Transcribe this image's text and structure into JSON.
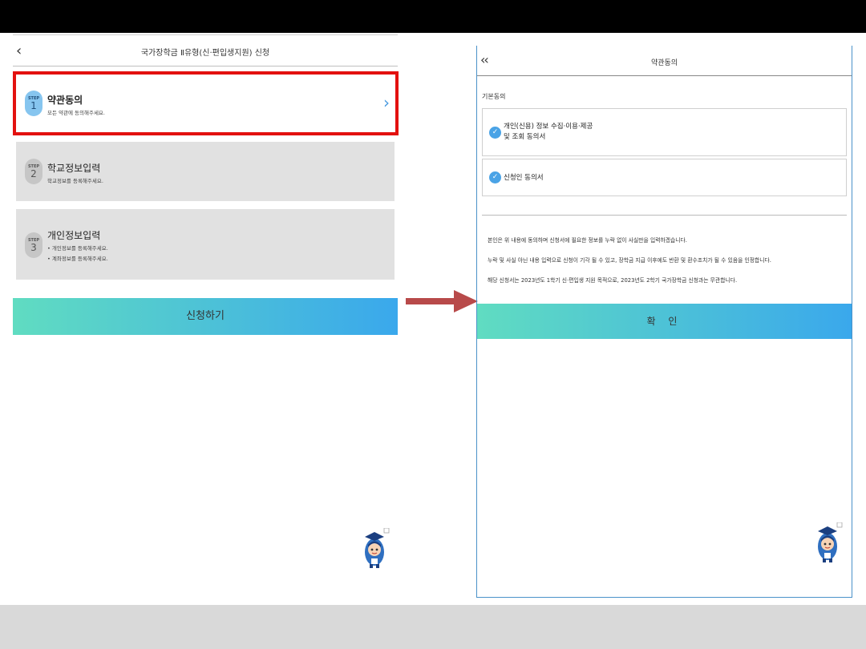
{
  "left_panel": {
    "header": {
      "back_icon": "chevron-left-icon",
      "title": "국가장학금 Ⅱ유형(신·편입생지원) 신청"
    },
    "steps": [
      {
        "step_label": "STEP",
        "number": "1",
        "title": "약관동의",
        "subtitle": "모든 약관에 동의해주세요.",
        "active": true
      },
      {
        "step_label": "STEP",
        "number": "2",
        "title": "학교정보입력",
        "subtitle": "학교정보를 등록해주세요.",
        "active": false
      },
      {
        "step_label": "STEP",
        "number": "3",
        "title": "개인정보입력",
        "bullets": [
          "• 개인정보를 등록해주세요.",
          "• 계좌정보를 등록해주세요."
        ],
        "active": false
      }
    ],
    "apply_button": "신청하기"
  },
  "right_panel": {
    "header": {
      "back_icon": "double-chevron-left-icon",
      "title": "약관동의"
    },
    "section_label": "기본동의",
    "agreements": [
      {
        "text_line1": "개인(신용) 정보 수집·이용·제공",
        "text_line2": "및 조회 동의서",
        "checked": true
      },
      {
        "text_line1": "신청인 동의서",
        "checked": true
      }
    ],
    "notices": [
      "본인은 위 내용에 동의하며 신청서에 필요한 정보를 누락 없이 사실만을 입력하겠습니다.",
      "누락 및 사실 아닌 내용 입력으로 신청이 기각 될 수 있고, 장학금 지급 이후에도 반환 및 환수조치가 될 수 있음을 인정합니다.",
      "해당 신청서는 2023년도 1학기 신·편입생 지원 목적으로, 2023년도 2학기 국가장학금 신청과는 무관합니다."
    ],
    "confirm_button": "확 인"
  },
  "colors": {
    "highlight": "#e3110f",
    "accent": "#3aa8ec",
    "gradient_start": "#60dcc1",
    "flow_arrow": "#b84a4a"
  }
}
